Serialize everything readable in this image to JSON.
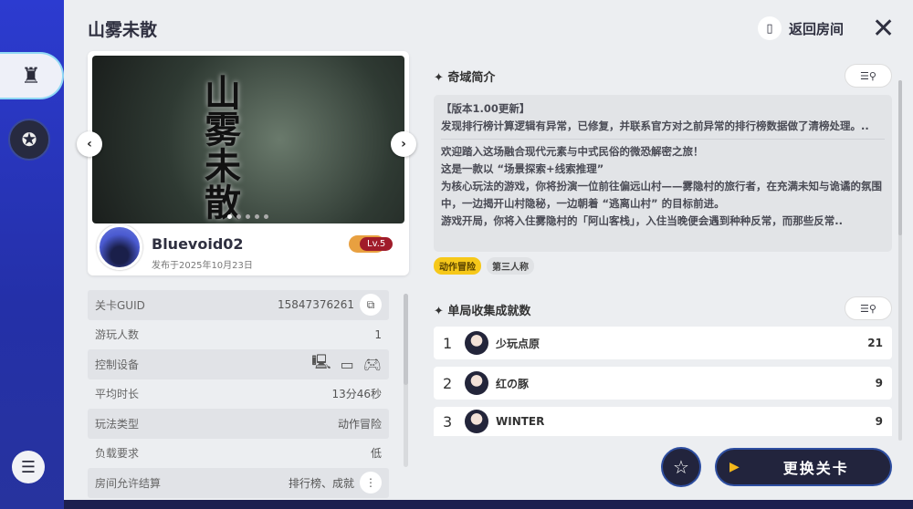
{
  "sidebar": {
    "tabs": [
      {
        "icon": "rook-icon",
        "active": true
      },
      {
        "icon": "medal-icon",
        "active": false
      }
    ],
    "menu_icon": "menu-icon"
  },
  "header": {
    "title": "山雾未散",
    "return_label": "返回房间",
    "close_icon": "close-icon"
  },
  "level_card": {
    "cover_title": "山雾未散",
    "carousel_pages": 5,
    "carousel_current": 1,
    "author": "Bluevoid02",
    "published": "发布于2025年10月23日",
    "level_badge": "Lv.5"
  },
  "properties": [
    {
      "label": "关卡GUID",
      "value": "15847376261",
      "action": "copy-icon"
    },
    {
      "label": "游玩人数",
      "value": "1"
    },
    {
      "label": "控制设备",
      "value": "",
      "devices": [
        "keyboard-mouse-icon",
        "touch-icon",
        "gamepad-icon"
      ]
    },
    {
      "label": "平均时长",
      "value": "13分46秒"
    },
    {
      "label": "玩法类型",
      "value": "动作冒险"
    },
    {
      "label": "负载要求",
      "value": "低"
    },
    {
      "label": "房间允许结算",
      "value": "排行榜、成就",
      "action": "more-icon"
    }
  ],
  "intro": {
    "heading": "奇域简介",
    "update": "【版本1.00更新】\n发现排行榜计算逻辑有异常，已修复，并联系官方对之前异常的排行榜数据做了清榜处理。..",
    "description": "欢迎踏入这场融合现代元素与中式民俗的微恐解密之旅！\n这是一款以 “场景探索+线索推理”\n为核心玩法的游戏，你将扮演一位前往偏远山村——雾隐村的旅行者，在充满未知与诡谲的氛围中，一边揭开山村隐秘，一边朝着 “逃离山村” 的目标前进。\n游戏开局，你将入住雾隐村的「阿山客栈」，入住当晚便会遇到种种反常，而那些反常..",
    "tags": [
      {
        "label": "动作冒险",
        "highlight": true
      },
      {
        "label": "第三人称",
        "highlight": false
      }
    ]
  },
  "achievements": {
    "heading": "单局收集成就数",
    "rows": [
      {
        "rank": "1",
        "name": "少玩点原",
        "count": "21"
      },
      {
        "rank": "2",
        "name": "红の豚",
        "count": "9"
      },
      {
        "rank": "3",
        "name": "WINTER",
        "count": "9"
      }
    ]
  },
  "actions": {
    "favorite_icon": "star-icon",
    "change_label": "更换关卡"
  },
  "colors": {
    "sidebar": "#2c3bd0",
    "panel": "#eceef1",
    "tag_highlight": "#f6c81a",
    "button_dark": "#22243d"
  }
}
